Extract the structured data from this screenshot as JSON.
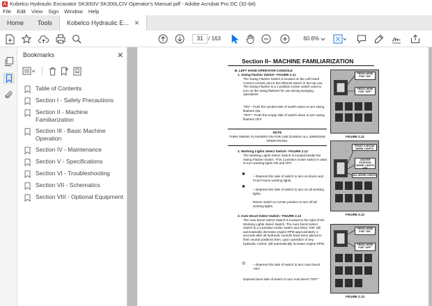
{
  "window": {
    "title": "Kobelco Hydraulic Excavator SK300IV SK300LCIV Operator's Manual.pdf - Adobe Acrobat Pro DC (32-bit)"
  },
  "menu": [
    "File",
    "Edit",
    "View",
    "Sign",
    "Window",
    "Help"
  ],
  "tabs": {
    "home": "Home",
    "tools": "Tools",
    "document": "Kobelco Hydraulic E..."
  },
  "toolbar": {
    "page_number": "31",
    "page_total": "/ 163",
    "zoom": "60.6%"
  },
  "bookmarks": {
    "header": "Bookmarks",
    "items": [
      "Table of Contents",
      "Section I - Safety Precautions",
      "Section II - Machine Familiarization",
      "Section III - Basic Machine Operation",
      "Section IV - Maintenance",
      "Section V - Specifications",
      "Section VI - Troubleshooting",
      "Section VII - Schematics",
      "Section VIII - Optional Equipment"
    ]
  },
  "page": {
    "section_title": "Section II– MACHINE FAMILIARIZATION",
    "b_heading": "B. LEFT HAND OPERATOR CONSOLE",
    "item1_heading": "1.  Swing Flasher Switch– FIGURE 2.11",
    "item1_body": "The Swing Flasher Switch is located on the Left Hand Control console and is the leftmost switch in the top row. The Swing Flasher is a 2 position rocker switch used to turn on the swing flashers for use during swinging operations.",
    "item1_on": "\"ON\"– Push the symbol side of switch down to turn swing flashers ON.",
    "item1_off": "\"OFF\"– Push the empty side of switch down to turn swing flashers OFF.",
    "note_label": "NOTE",
    "note_text": "TURN SWING FLASHERS ON FOR USE DURING ALL SWINGING OPERATIONS.",
    "item2_heading": "2.  Working Lights Select Switch– FIGURE 2.12",
    "item2_body": "The Working Lights Select Switch is located beside the Swing Flasher Switch. This 3 position rocker switch is used to turn working lights ON and OFF.",
    "item2_boom": "– Depress this side of switch to turn on Boom and Front Frame working lights.",
    "item2_all": "– Depress this side of switch to turn on all working lights.",
    "item2_center": "Return switch to Center position to turn off all working lights.",
    "item3_heading": "3.  Auto Decel Select Switch– FIGURE 2.13",
    "item3_body": "The Auto Decel Select Switch is located to the right of the Working Lights Select Switch. The Auto Decel Select Switch is a 2 position rocker switch and when \"ON\" will automatically decrease engine RPM approximately 4 seconds after all hydraulic controls have been placed in their neutral positions then, upon operation of any hydraulic control, will automatically increase engine RPM.",
    "item3_on": "– Depress this side of switch to turn Auto Decel \"ON\".",
    "item3_off": "Depress back side of switch to turn Auto Decel \"OFF\".",
    "fig1_caption": "FIGURE 2.11",
    "fig2_caption": "FIGURE 2.12",
    "fig3_caption": "FIGURE 2.13",
    "fig1_callout_on": "PRESS HERE FOR \"ON\"",
    "fig1_callout_off": "PRESS HERE FOR \"OFF\"",
    "fig2_callout_boom": "FRONT & BOOM WORK LIGHTS",
    "fig2_callout_center": "CENTER POSITION WORK LIGHTS OFF",
    "fig2_callout_all": "ALL WORK LIGHTS",
    "fig3_callout_on": "PRESS HERE FOR \"ON\"",
    "fig3_callout_off": "PRESS HERE FOR \"OFF\""
  },
  "colors": {
    "acrobat_red": "#d0312d",
    "accent_blue": "#1473e6"
  }
}
